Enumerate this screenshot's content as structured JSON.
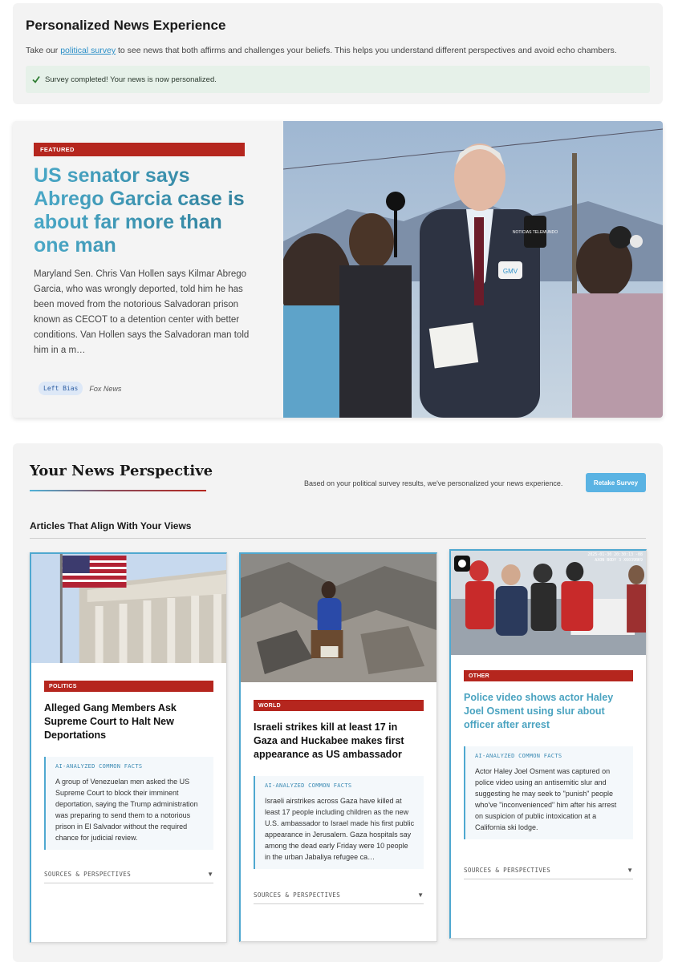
{
  "survey": {
    "title": "Personalized News Experience",
    "desc_before": "Take our ",
    "link": "political survey",
    "desc_after": " to see news that both affirms and challenges your beliefs. This helps you understand different perspectives and avoid echo chambers.",
    "success": "Survey completed! Your news is now personalized."
  },
  "featured": {
    "badge": "FEATURED",
    "title": "US senator says Abrego Garcia case is about far more than one man",
    "body": "Maryland Sen. Chris Van Hollen says Kilmar Abrego Garcia, who was wrongly deported, told him he has been moved from the notorious Salvadoran prison known as CECOT to a detention center with better conditions. Van Hollen says the Salvadoran man told him in a m…",
    "bias": "Left Bias",
    "source": "Fox News"
  },
  "perspective": {
    "title": "Your News Perspective",
    "note": "Based on your political survey results, we've personalized your news experience.",
    "retake": "Retake Survey",
    "align_heading": "Articles That Align With Your Views"
  },
  "cards": [
    {
      "category": "POLITICS",
      "title": "Alleged Gang Members Ask Supreme Court to Halt New Deportations",
      "facts_label": "AI-ANALYZED COMMON FACTS",
      "facts": "A group of Venezuelan men asked the US Supreme Court to block their imminent deportation, saying the Trump administration was preparing to send them to a notorious prison in El Salvador without the required chance for judicial review.",
      "sources": "SOURCES & PERSPECTIVES"
    },
    {
      "category": "WORLD",
      "title": "Israeli strikes kill at least 17 in Gaza and Huckabee makes first appearance as US ambassador",
      "facts_label": "AI-ANALYZED COMMON FACTS",
      "facts": "Israeli airstrikes across Gaza have killed at least 17 people including children as the new U.S. ambassador to Israel made his first public appearance in Jerusalem. Gaza hospitals say among the dead early Friday were 10 people in the urban Jabaliya refugee ca…",
      "sources": "SOURCES & PERSPECTIVES"
    },
    {
      "category": "OTHER",
      "title": "Police video shows actor Haley Joel Osment using slur about officer after arrest",
      "facts_label": "AI-ANALYZED COMMON FACTS",
      "facts": "Actor Haley Joel Osment was captured on police video using an antisemitic slur and suggesting he may seek to \"punish\" people who've \"inconvenienced\" him after his arrest on suspicion of public intoxication at a California ski lodge.",
      "sources": "SOURCES & PERSPECTIVES",
      "timestamp": "2025-01-30 20:30:13 -08",
      "camera_id": "AXON BODY 3 X6039BK9"
    }
  ],
  "logos": {
    "telemundo": "NOTICIAS TELEMUNDO",
    "gmv": "GMV"
  }
}
